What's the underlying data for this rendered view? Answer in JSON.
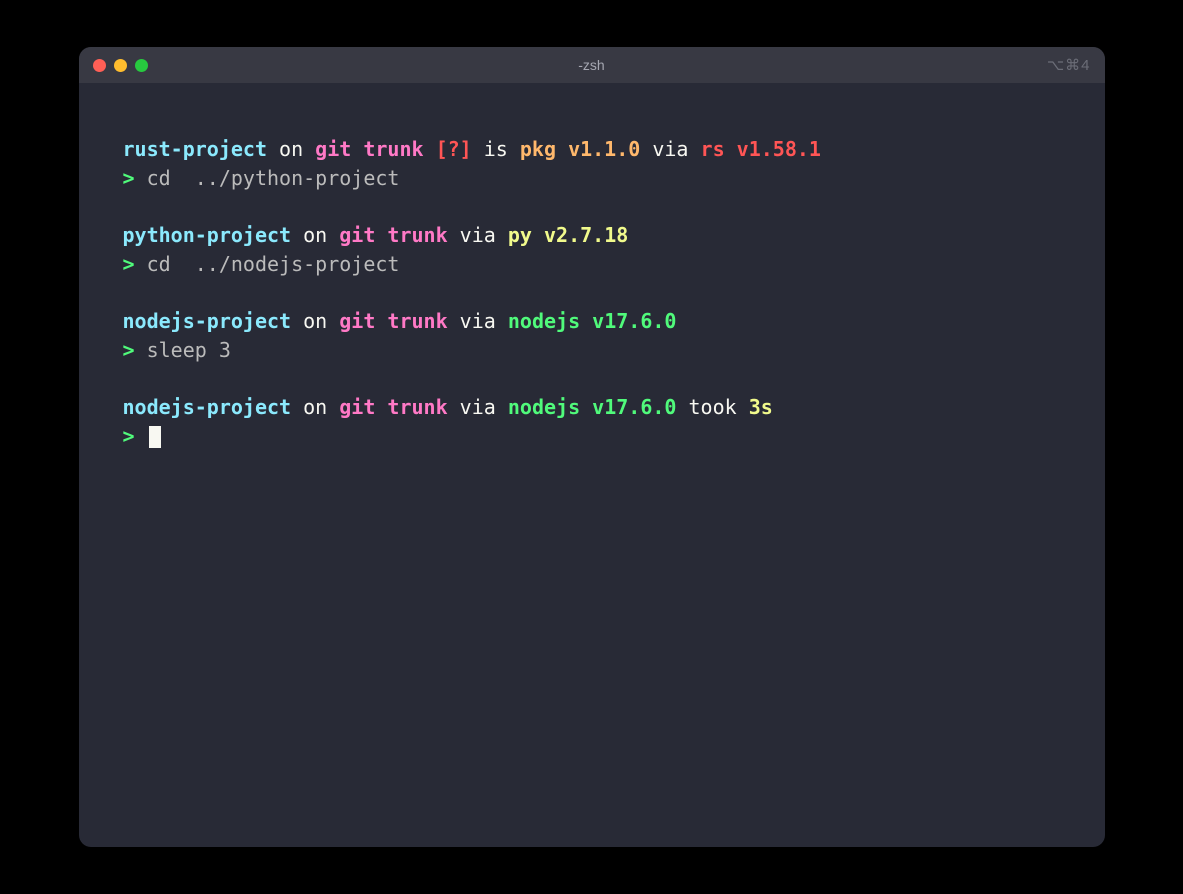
{
  "window": {
    "title": "-zsh",
    "shortcut": "⌥⌘4"
  },
  "blocks": [
    {
      "prompt": {
        "dir": "rust-project",
        "on": " on ",
        "git": "git ",
        "branch": "trunk ",
        "status": "[?]",
        "is": " is ",
        "pkg": "pkg ",
        "pkgver": "v1.1.0",
        "via": " via ",
        "lang": "rs ",
        "langver": "v1.58.1"
      },
      "prompt_char": "> ",
      "command": "cd  ../python-project"
    },
    {
      "prompt": {
        "dir": "python-project",
        "on": " on ",
        "git": "git ",
        "branch": "trunk",
        "via": " via ",
        "lang": "py ",
        "langver": "v2.7.18"
      },
      "prompt_char": "> ",
      "command": "cd  ../nodejs-project"
    },
    {
      "prompt": {
        "dir": "nodejs-project",
        "on": " on ",
        "git": "git ",
        "branch": "trunk",
        "via": " via ",
        "lang": "nodejs ",
        "langver": "v17.6.0"
      },
      "prompt_char": "> ",
      "command": "sleep 3"
    },
    {
      "prompt": {
        "dir": "nodejs-project",
        "on": " on ",
        "git": "git ",
        "branch": "trunk",
        "via": " via ",
        "lang": "nodejs ",
        "langver": "v17.6.0",
        "took": " took ",
        "duration": "3s"
      },
      "prompt_char": "> ",
      "command": ""
    }
  ]
}
